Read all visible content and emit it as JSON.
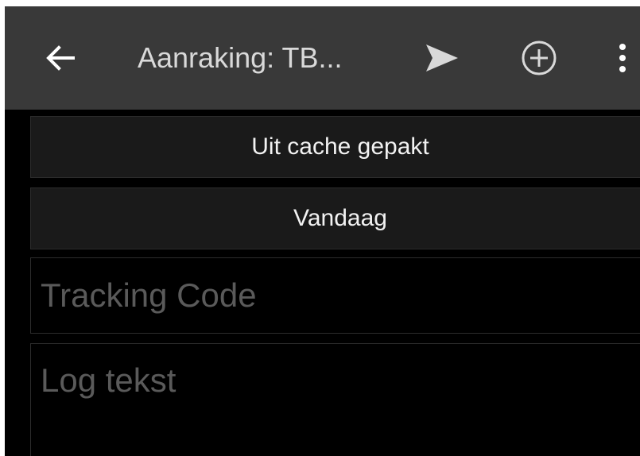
{
  "toolbar": {
    "back_icon": "arrow-left-icon",
    "title": "Aanraking: TB...",
    "send_icon": "send-icon",
    "add_icon": "add-circle-icon",
    "more_icon": "more-vert-icon",
    "icon_color": "#ffffff",
    "background": "#393939"
  },
  "form": {
    "cache_button_label": "Uit cache gepakt",
    "date_button_label": "Vandaag",
    "tracking_placeholder": "Tracking Code",
    "log_placeholder": "Log tekst"
  }
}
